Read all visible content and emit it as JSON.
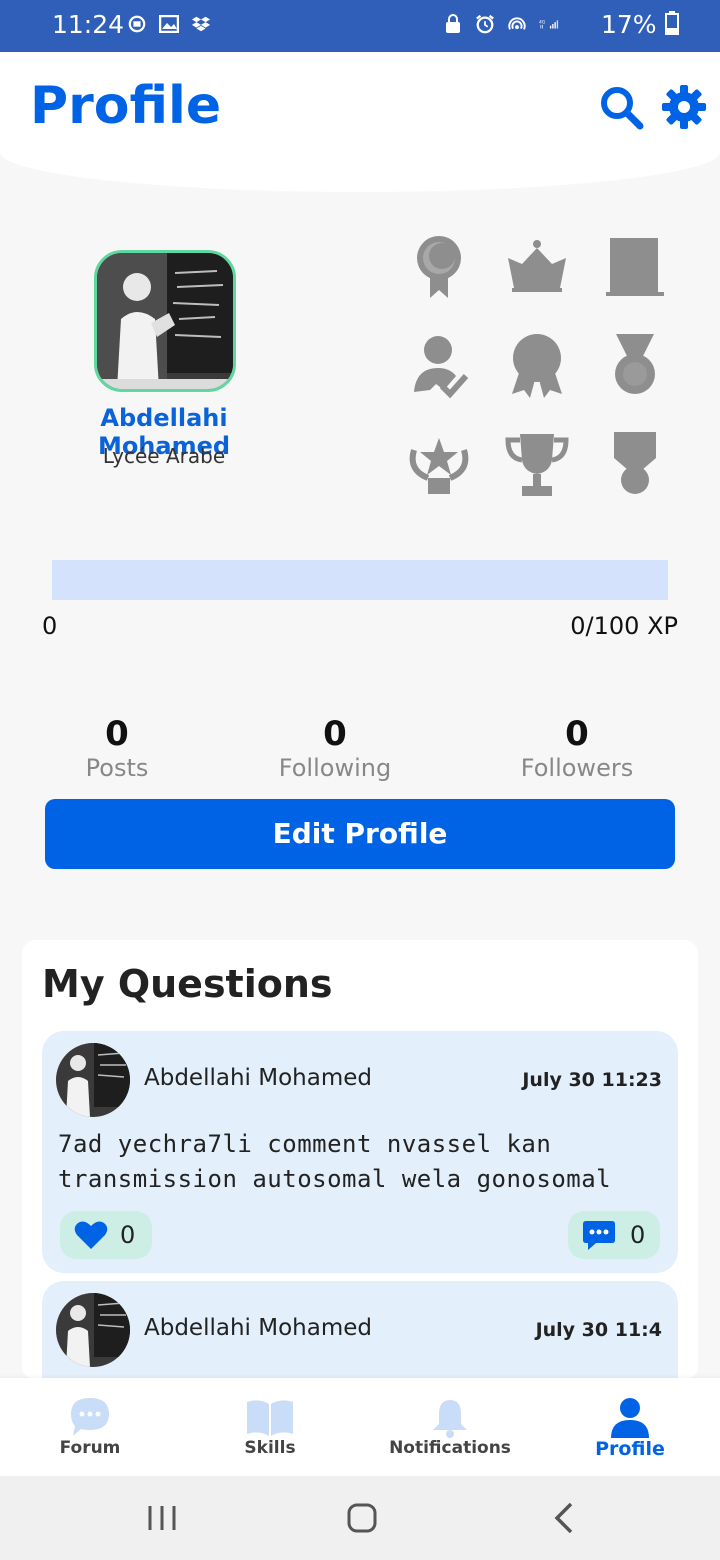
{
  "status_bar": {
    "time": "11:24",
    "battery": "17%",
    "network": "4G"
  },
  "header": {
    "title": "Profile"
  },
  "user": {
    "name": "Abdellahi Mohamed",
    "school": "Lycée  Arabe"
  },
  "xp": {
    "min_label": "0",
    "max_label": "0/100 XP",
    "progress": 0
  },
  "stats": {
    "posts": {
      "value": "0",
      "label": "Posts"
    },
    "following": {
      "value": "0",
      "label": "Following"
    },
    "followers": {
      "value": "0",
      "label": "Followers"
    }
  },
  "edit_button": "Edit Profile",
  "questions": {
    "title": "My Questions",
    "items": [
      {
        "author": "Abdellahi Mohamed",
        "date": "July 30  11:23",
        "text": "7ad yechra7li comment nvassel kan transmission autosomal wela gonosomal",
        "likes": "0",
        "comments": "0"
      },
      {
        "author": "Abdellahi Mohamed",
        "date": "July 30  11:4",
        "text": "",
        "likes": "",
        "comments": ""
      }
    ]
  },
  "bottom_nav": {
    "items": [
      {
        "label": "Forum",
        "icon": "forum-icon"
      },
      {
        "label": "Skills",
        "icon": "book-icon"
      },
      {
        "label": "Notifications",
        "icon": "bell-icon"
      },
      {
        "label": "Profile",
        "icon": "user-icon"
      }
    ],
    "active": "Profile"
  },
  "badge_icons": [
    "medal-ribbon-icon",
    "crown-icon",
    "certificate-icon",
    "user-check-icon",
    "award-rosette-icon",
    "medal-icon",
    "laurel-star-icon",
    "trophy-icon",
    "military-medal-icon"
  ],
  "colors": {
    "accent": "#0063e6",
    "status_bar": "#2f5fb8",
    "card_bg": "#e3f0fc",
    "reaction_bg": "#cdeee5",
    "badge_locked": "#8e8e8e",
    "avatar_border": "#5fd8a0"
  }
}
